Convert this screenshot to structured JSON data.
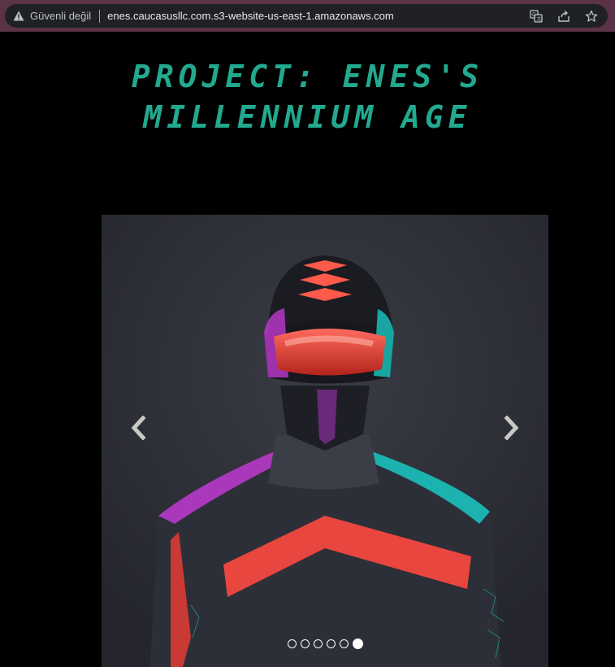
{
  "browser": {
    "security_label": "Güvenli değil",
    "url": "enes.caucasusllc.com.s3-website-us-east-1.amazonaws.com",
    "icons": [
      "warning-icon",
      "translate-icon",
      "share-icon",
      "star-icon"
    ]
  },
  "page": {
    "title_line1": "Project: Enes's",
    "title_line2": "Millennium Age"
  },
  "carousel": {
    "slide_count": 6,
    "active_index": 5,
    "prev_icon": "chevron-left-icon",
    "next_icon": "chevron-right-icon"
  },
  "colors": {
    "title": "#22a98f",
    "chrome": "#5a3346",
    "omnibox": "#202124"
  }
}
